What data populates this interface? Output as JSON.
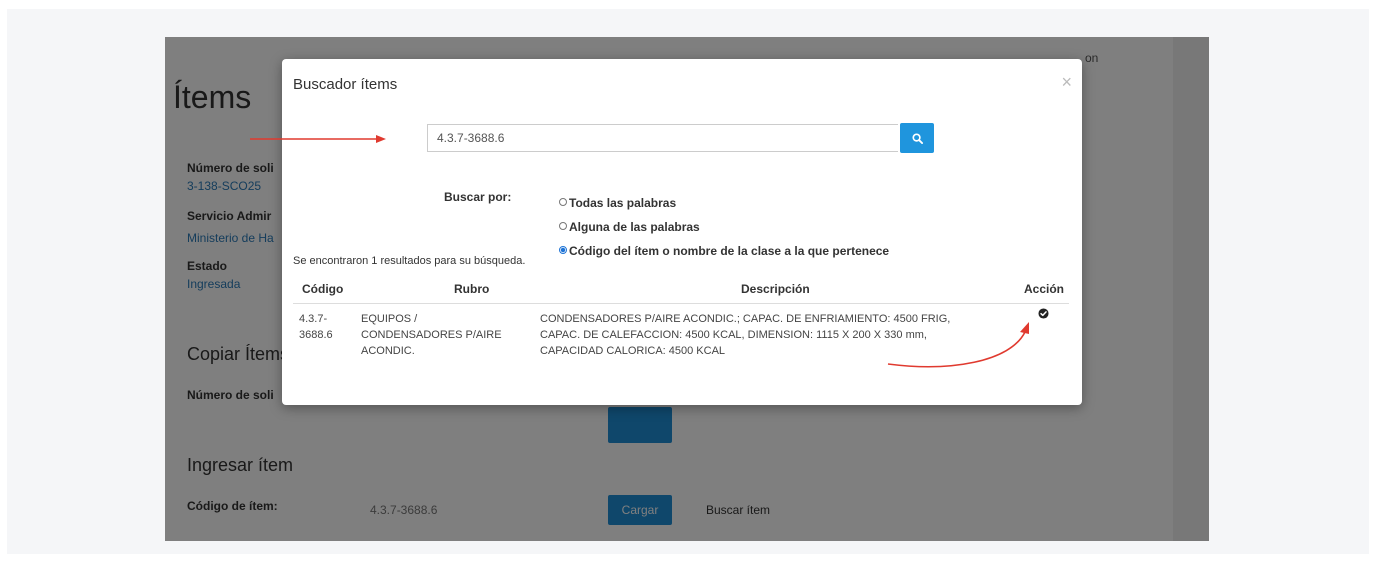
{
  "background_page": {
    "title": "Ítems",
    "top_text": [
      "...",
      "...",
      "...",
      "on"
    ],
    "fields": [
      {
        "label": "Número de soli",
        "value": "3-138-SCO25"
      },
      {
        "label": "Servicio Admir",
        "value": "Ministerio de Ha"
      },
      {
        "label": "Estado",
        "value": "Ingresada"
      }
    ],
    "copy_section": {
      "title": "Copiar Ítems",
      "label": "Número de soli"
    },
    "add_section": {
      "title": "Ingresar ítem",
      "code_label": "Código de ítem:",
      "code_value": "4.3.7-3688.6",
      "load_button": "Cargar",
      "search_button": "Buscar ítem"
    }
  },
  "modal": {
    "title": "Buscador ítems",
    "close_icon": "close-icon",
    "search": {
      "value": "4.3.7-3688.6",
      "icon": "search-icon",
      "button_color": "#1f95dd"
    },
    "search_by_label": "Buscar por:",
    "search_options": [
      {
        "label": "Todas las palabras",
        "selected": false
      },
      {
        "label": "Alguna de las palabras",
        "selected": false
      },
      {
        "label": "Código del ítem o nombre de la clase a la que pertenece",
        "selected": true
      }
    ],
    "results_text": "Se encontraron 1 resultados para su búsqueda.",
    "table": {
      "headers": [
        "Código",
        "Rubro",
        "Descripción",
        "Acción"
      ],
      "rows": [
        {
          "codigo": "4.3.7-3688.6",
          "codigo_lines": [
            "4.3.7-",
            "3688.6"
          ],
          "rubro_lines": [
            "EQUIPOS /",
            "CONDENSADORES P/AIRE",
            "ACONDIC."
          ],
          "descripcion_lines": [
            "CONDENSADORES P/AIRE ACONDIC.; CAPAC. DE ENFRIAMIENTO: 4500 FRIG,",
            "CAPAC. DE CALEFACCION: 4500 KCAL, DIMENSION: 1115 X 200 X 330 mm,",
            "CAPACIDAD CALORICA: 4500 KCAL"
          ],
          "action_icon": "check-circle-icon"
        }
      ]
    }
  },
  "annotations": {
    "arrow_color": "#e03a2f"
  }
}
